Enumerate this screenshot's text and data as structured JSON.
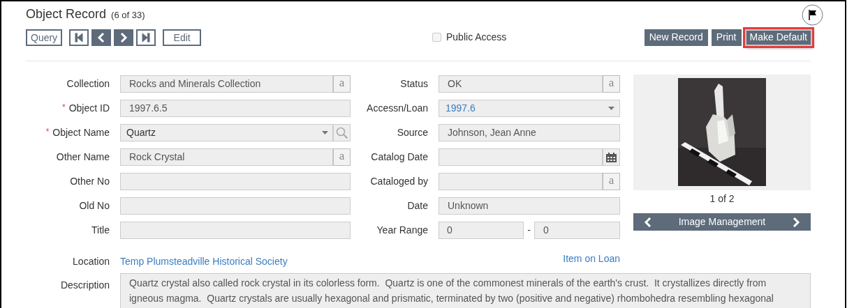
{
  "header": {
    "title": "Object Record",
    "count": "(6 of 33)"
  },
  "toolbar": {
    "query": "Query",
    "nav_buttons": [
      {
        "kind": "first",
        "disabled": true
      },
      {
        "kind": "prev",
        "disabled": false
      },
      {
        "kind": "next",
        "disabled": false
      },
      {
        "kind": "last",
        "disabled": true
      }
    ],
    "edit": "Edit"
  },
  "public_access": {
    "label": "Public Access",
    "checked": false
  },
  "action_buttons": [
    {
      "label": "New Record",
      "highlighted": false
    },
    {
      "label": "Print",
      "highlighted": false
    },
    {
      "label": "Make Default",
      "highlighted": true
    }
  ],
  "left_fields": [
    {
      "label": "Collection",
      "kind": "lookup",
      "value": "Rocks and Minerals Collection",
      "lookup": "a"
    },
    {
      "label": "Object ID",
      "required_mark": "*",
      "kind": "text",
      "value": "1997.6.5"
    },
    {
      "label": "Object Name",
      "required_mark": "*",
      "kind": "dropdown_search",
      "value": "Quartz"
    },
    {
      "label": "Other Name",
      "kind": "lookup",
      "value": "Rock Crystal",
      "lookup": "a"
    },
    {
      "label": "Other No",
      "kind": "text"
    },
    {
      "label": "Old No",
      "kind": "text"
    },
    {
      "label": "Title",
      "kind": "text"
    }
  ],
  "right_fields": [
    {
      "label": "Status",
      "kind": "lookup",
      "value": "OK",
      "lookup": "a"
    },
    {
      "label": "Accessn/Loan",
      "kind": "dropdown",
      "value": "1997.6",
      "link": true
    },
    {
      "label": "Source",
      "kind": "text",
      "value": "Johnson, Jean Anne"
    },
    {
      "label": "Catalog Date",
      "kind": "date"
    },
    {
      "label": "Cataloged by",
      "kind": "lookup",
      "lookup": "a"
    },
    {
      "label": "Date",
      "kind": "text",
      "value": "Unknown"
    },
    {
      "label": "Year Range",
      "kind": "range",
      "from": "0",
      "separator": "-",
      "to": "0"
    }
  ],
  "location": {
    "label": "Location",
    "value": "Temp Plumsteadville Historical Society"
  },
  "item_on_loan": "Item on Loan",
  "image_panel": {
    "counter": "1 of 2",
    "management": "Image Management"
  },
  "description": {
    "label": "Description",
    "text": "Quartz crystal also called rock crystal in its colorless form.  Quartz is one of the commonest minerals of the earth's crust.  It crystallizes directly from igneous magma.  Quartz crystals are usually hexagonal and prismatic, terminated by two (positive and negative) rhombohedra resembling hexagonal"
  }
}
